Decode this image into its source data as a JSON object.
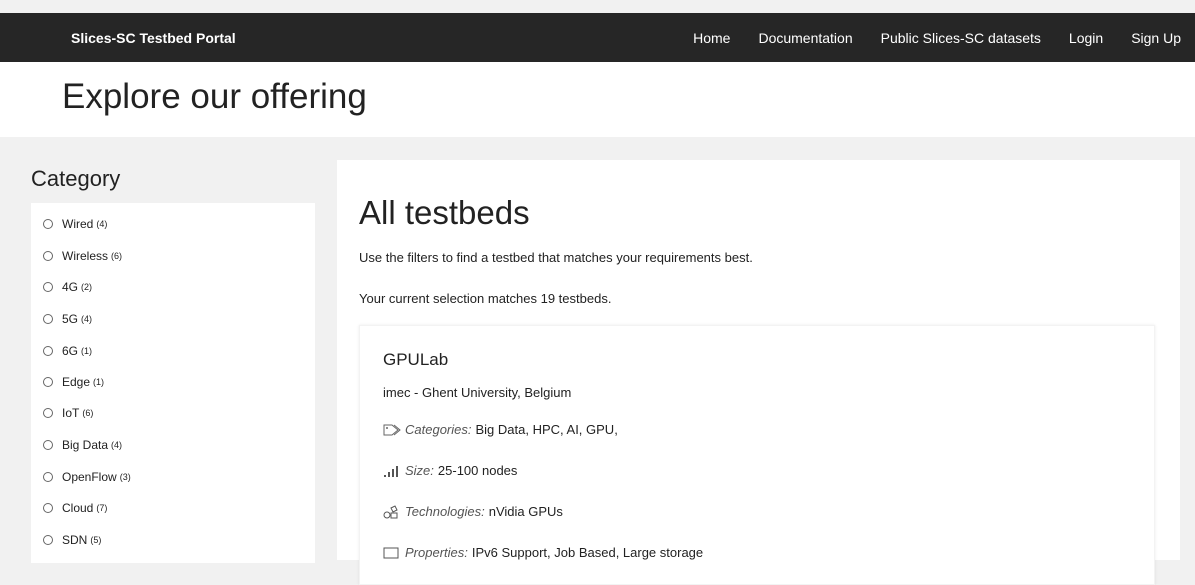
{
  "header": {
    "brand": "Slices-SC Testbed Portal",
    "nav": [
      "Home",
      "Documentation",
      "Public Slices-SC datasets",
      "Login",
      "Sign Up"
    ]
  },
  "hero": {
    "title": "Explore our offering"
  },
  "sidebar": {
    "title": "Category",
    "items": [
      {
        "label": "Wired",
        "count": "(4)"
      },
      {
        "label": "Wireless",
        "count": "(6)"
      },
      {
        "label": "4G",
        "count": "(2)"
      },
      {
        "label": "5G",
        "count": "(4)"
      },
      {
        "label": "6G",
        "count": "(1)"
      },
      {
        "label": "Edge",
        "count": "(1)"
      },
      {
        "label": "IoT",
        "count": "(6)"
      },
      {
        "label": "Big Data",
        "count": "(4)"
      },
      {
        "label": "OpenFlow",
        "count": "(3)"
      },
      {
        "label": "Cloud",
        "count": "(7)"
      },
      {
        "label": "SDN",
        "count": "(5)"
      }
    ]
  },
  "main": {
    "title": "All testbeds",
    "description": "Use the filters to find a testbed that matches your requirements best.",
    "match_text": "Your current selection matches 19 testbeds.",
    "card": {
      "title": "GPULab",
      "org": "imec - Ghent University, Belgium",
      "categories_label": "Categories:",
      "categories_value": "Big Data, HPC, AI, GPU,",
      "size_label": "Size:",
      "size_value": "25-100 nodes",
      "tech_label": "Technologies:",
      "tech_value": "nVidia GPUs",
      "props_label": "Properties:",
      "props_value": "IPv6 Support, Job Based, Large storage"
    }
  },
  "colors": {
    "topbar": "#262626",
    "page_bg": "#f1f1f1"
  }
}
